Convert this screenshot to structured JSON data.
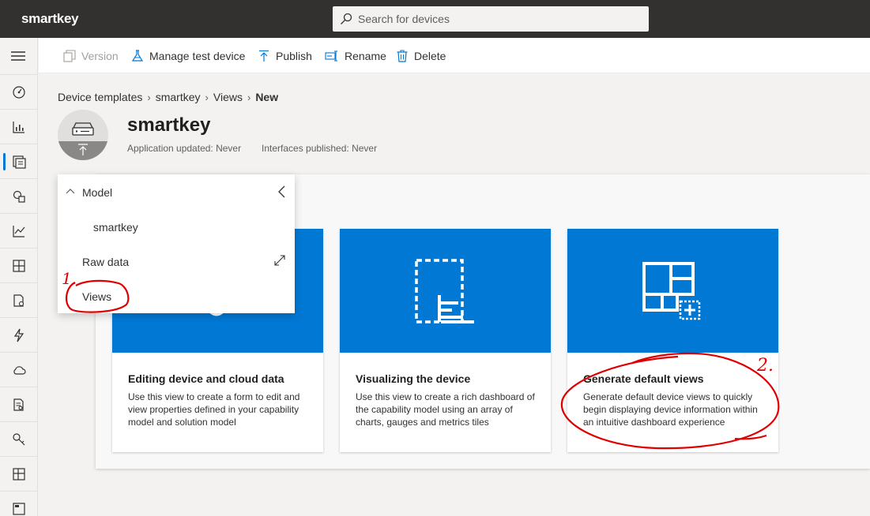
{
  "app": {
    "brand": "smartkey"
  },
  "search": {
    "placeholder": "Search for devices",
    "icon": "search-icon"
  },
  "commands": {
    "version": "Version",
    "manage_test_device": "Manage test device",
    "publish": "Publish",
    "rename": "Rename",
    "delete": "Delete"
  },
  "breadcrumb": {
    "items": [
      "Device templates",
      "smartkey",
      "Views"
    ],
    "current": "New"
  },
  "header": {
    "title": "smartkey",
    "app_updated": "Application updated: Never",
    "interfaces_published": "Interfaces published: Never"
  },
  "nav_menu": {
    "section": "Model",
    "items": [
      "smartkey",
      "Raw data",
      "Views"
    ]
  },
  "cards": [
    {
      "title": "Editing device and cloud data",
      "description": "Use this view to create a form to edit and view properties defined in your capability model and solution model"
    },
    {
      "title": "Visualizing the device",
      "description": "Use this view to create a rich dashboard of the capability model using an array of charts, gauges and metrics tiles"
    },
    {
      "title": "Generate default views",
      "description": "Generate default device views to quickly begin displaying device information within an intuitive dashboard experience"
    }
  ],
  "annotations": {
    "first": "1.",
    "second": "2."
  },
  "colors": {
    "accent": "#0078d4",
    "topbar": "#323130",
    "annotation": "#e00000"
  }
}
